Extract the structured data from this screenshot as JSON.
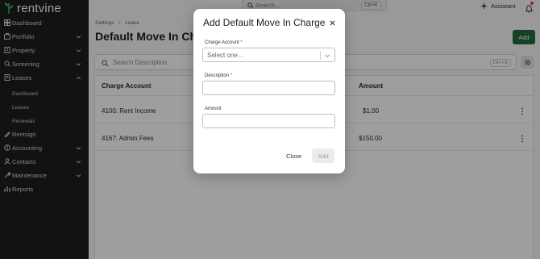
{
  "app": {
    "brand": "rentvine"
  },
  "sidebar": {
    "items": [
      {
        "label": "Dashboard",
        "icon": "dashboard-icon",
        "has_chevron": false
      },
      {
        "label": "Portfolio",
        "icon": "briefcase-icon",
        "has_chevron": true
      },
      {
        "label": "Property",
        "icon": "building-icon",
        "has_chevron": true
      },
      {
        "label": "Screening",
        "icon": "screening-icon",
        "has_chevron": true
      },
      {
        "label": "Leases",
        "icon": "leases-icon",
        "has_chevron": true,
        "expanded": true
      },
      {
        "label": "Rentsign",
        "icon": "rentsign-icon",
        "has_chevron": false
      },
      {
        "label": "Accounting",
        "icon": "accounting-icon",
        "has_chevron": true
      },
      {
        "label": "Contacts",
        "icon": "contacts-icon",
        "has_chevron": true
      },
      {
        "label": "Maintenance",
        "icon": "wrench-icon",
        "has_chevron": true
      },
      {
        "label": "Reports",
        "icon": "reports-icon",
        "has_chevron": false
      }
    ],
    "leases_sub": [
      "Dashboard",
      "Leases",
      "Renewals"
    ]
  },
  "header": {
    "search_placeholder": "Search...",
    "search_shortcut": "Ctrl+K",
    "assistant_label": "Assistant"
  },
  "breadcrumb": {
    "first": "Settings",
    "separator": "/",
    "second": "Lease"
  },
  "page": {
    "title": "Default Move In Charges",
    "add_label": "Add",
    "search_placeholder": "Search Description",
    "search_shortcut": "Ctrl + K"
  },
  "table": {
    "columns": {
      "charge_account": "Charge Account",
      "amount": "Amount"
    },
    "rows": [
      {
        "charge_account": "4100: Rent Income",
        "amount": "$1.00"
      },
      {
        "charge_account": "4167: Admin Fees",
        "amount": "$150.00"
      }
    ]
  },
  "modal": {
    "title": "Add Default Move In Charge",
    "charge_account_label": "Charge Account",
    "charge_account_placeholder": "Select one...",
    "description_label": "Description",
    "amount_label": "Amount",
    "required_mark": "*",
    "close_label": "Close",
    "add_label": "Add"
  },
  "colors": {
    "sidebar_bg": "#1e1e1e",
    "primary": "#1f6b3a",
    "required": "#c0392b"
  }
}
